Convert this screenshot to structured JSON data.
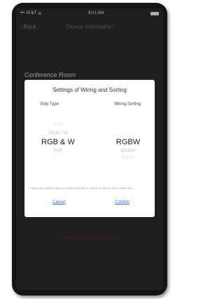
{
  "status_bar": {
    "carrier": "AT&T",
    "wifi_icon": "wifi-icon",
    "time": "8:01 AM"
  },
  "nav": {
    "back_label": "Back",
    "title": "Device Information"
  },
  "underlay": {
    "room_name": "Conference Room",
    "red_link": "TAP HERE TO RESET DEVICE"
  },
  "modal": {
    "title": "Settings of Wiring and Sorting",
    "columns": {
      "strip_type": "Strip Type",
      "wiring_sorting": "Wiring Sorting"
    },
    "strip_type_options": [
      "RGB",
      "RGB / W",
      "RGB & W",
      "DIM"
    ],
    "strip_type_selected": "RGB & W",
    "wiring_options": [
      "RGBW",
      "GRBW",
      "BRGW"
    ],
    "wiring_selected": "RGBW",
    "note": "* means to unable W light on at the same time & means W light on at the same time.",
    "cancel_label": "Cancel",
    "confirm_label": "Confirm"
  },
  "colors": {
    "accent": "#2f6fd0",
    "modal_bg": "#ffffff",
    "screen_bg": "#2a2a2a"
  }
}
